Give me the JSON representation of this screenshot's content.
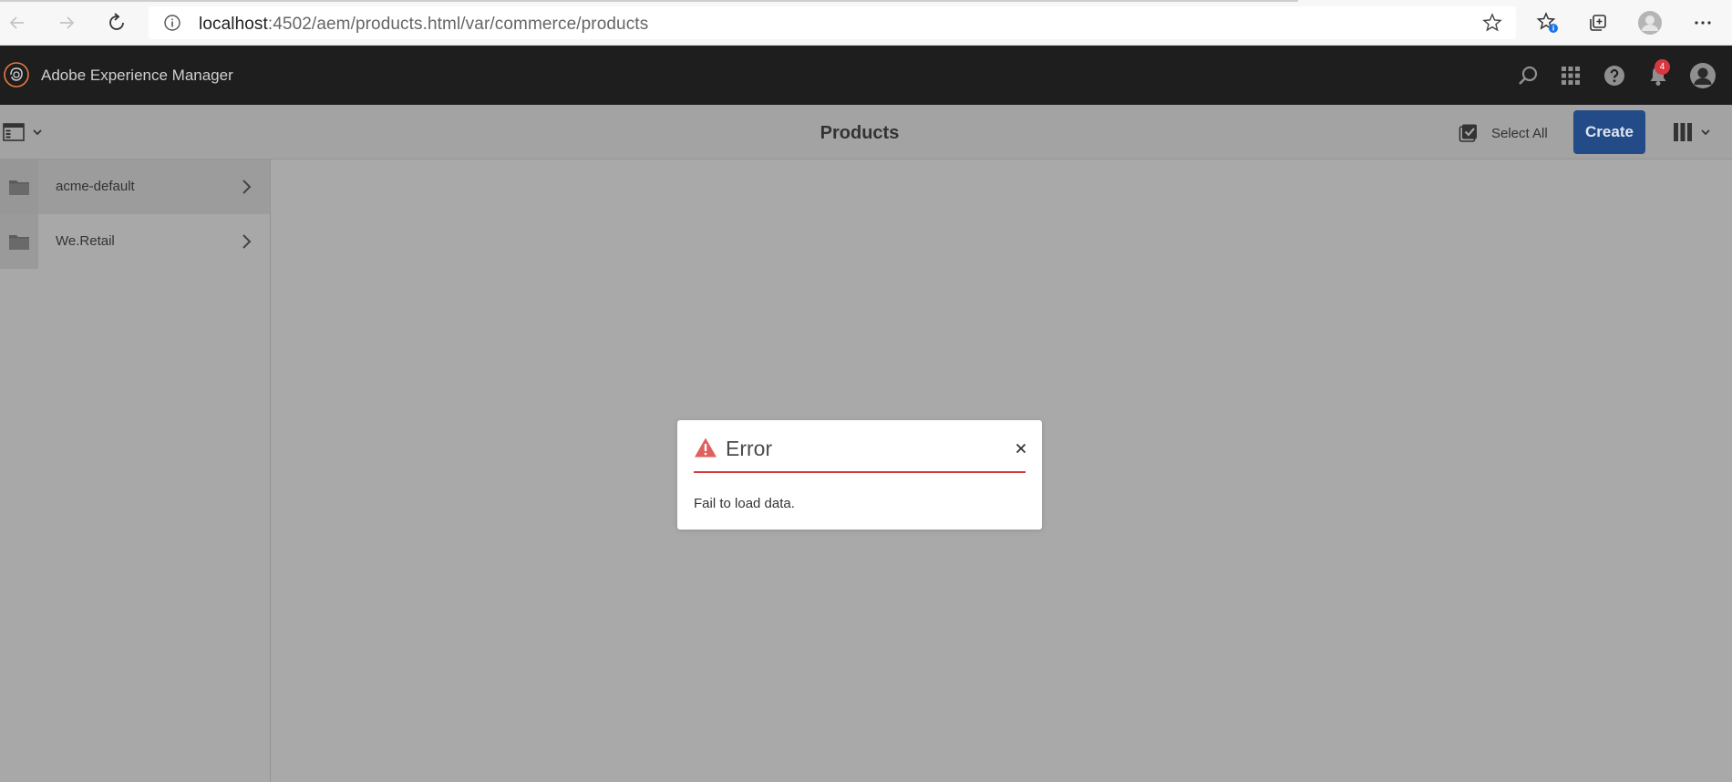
{
  "browser": {
    "url_host": "localhost",
    "url_path": ":4502/aem/products.html/var/commerce/products"
  },
  "shell": {
    "app_title": "Adobe Experience Manager",
    "notification_count": "4"
  },
  "actionbar": {
    "title": "Products",
    "select_all_label": "Select All",
    "create_label": "Create"
  },
  "column": {
    "items": [
      {
        "label": "acme-default"
      },
      {
        "label": "We.Retail"
      }
    ]
  },
  "dialog": {
    "title": "Error",
    "message": "Fail to load data."
  },
  "colors": {
    "shell_header": "#1e1e1e",
    "overlay_gray": "#a9a9a9",
    "create_button": "#234b87",
    "error_accent": "#d7373f",
    "logo_orange": "#e8793f"
  },
  "icons": {
    "browser": [
      "back-arrow-icon",
      "forward-arrow-icon",
      "refresh-icon",
      "info-icon",
      "star-icon",
      "favorites-icon",
      "collections-icon",
      "profile-icon",
      "more-icon"
    ],
    "shell": [
      "adobe-logo-icon",
      "search-icon",
      "apps-grid-icon",
      "help-icon",
      "bell-icon",
      "user-avatar-icon"
    ],
    "actionbar": [
      "rail-toggle-icon",
      "chevron-down-icon",
      "checkbox-icon",
      "column-view-icon"
    ],
    "column": [
      "folder-icon",
      "chevron-right-icon"
    ],
    "dialog": [
      "alert-icon",
      "close-icon"
    ]
  }
}
